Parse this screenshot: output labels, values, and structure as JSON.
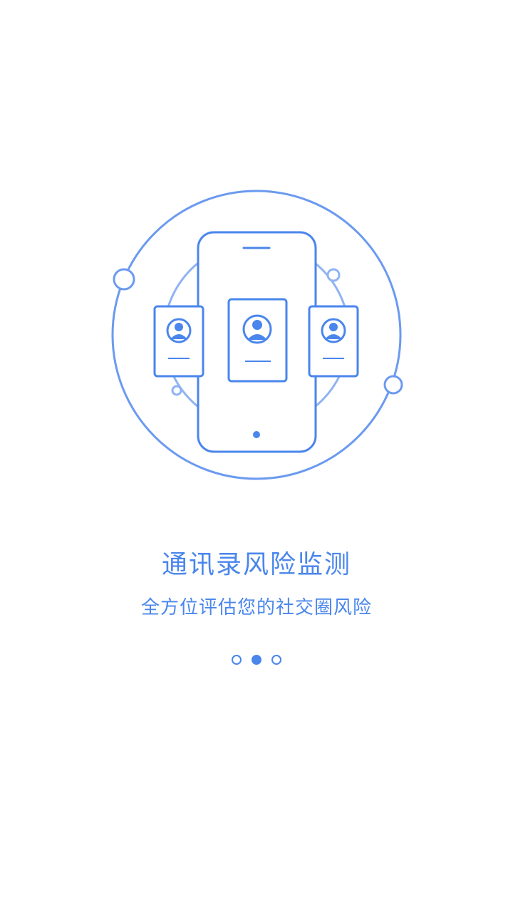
{
  "onboarding": {
    "title": "通讯录风险监测",
    "subtitle": "全方位评估您的社交圈风险",
    "page_indicator": {
      "total": 3,
      "current": 2
    },
    "illustration": "phone-with-contact-cards-icon"
  },
  "colors": {
    "accent": "#4a86ec",
    "accent_light": "#7fa8f2",
    "background": "#ffffff"
  }
}
